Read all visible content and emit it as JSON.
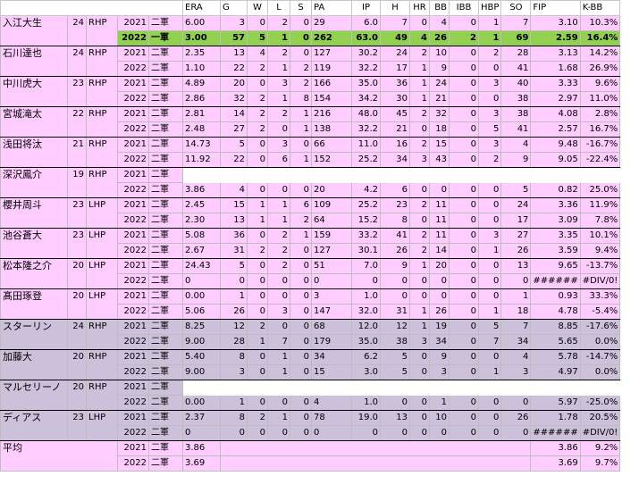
{
  "headers": [
    "ERA",
    "G",
    "W",
    "L",
    "S",
    "PA",
    "IP",
    "H",
    "HR",
    "BB",
    "IBB",
    "HBP",
    "SO",
    "FIP",
    "K-BB"
  ],
  "players": [
    {
      "name": "入江大生",
      "age": "24",
      "throws": "RHP",
      "bg": "pink",
      "rows": [
        {
          "year": "2021",
          "level": "二軍",
          "stats": [
            "6.00",
            "3",
            "0",
            "2",
            "0",
            "29",
            "6.0",
            "7",
            "0",
            "4",
            "0",
            "1",
            "7",
            "3.10",
            "10.3%"
          ]
        },
        {
          "year": "2022",
          "level": "一軍",
          "highlight": true,
          "stats": [
            "3.00",
            "57",
            "5",
            "1",
            "0",
            "262",
            "63.0",
            "49",
            "4",
            "26",
            "2",
            "1",
            "69",
            "2.59",
            "16.4%"
          ]
        }
      ]
    },
    {
      "name": "石川達也",
      "age": "24",
      "throws": "RHP",
      "bg": "pink",
      "rows": [
        {
          "year": "2021",
          "level": "二軍",
          "stats": [
            "2.35",
            "13",
            "4",
            "2",
            "0",
            "127",
            "30.2",
            "24",
            "2",
            "10",
            "0",
            "2",
            "28",
            "3.13",
            "14.2%"
          ]
        },
        {
          "year": "2022",
          "level": "二軍",
          "stats": [
            "1.10",
            "22",
            "2",
            "1",
            "2",
            "119",
            "32.2",
            "17",
            "1",
            "9",
            "0",
            "0",
            "41",
            "1.68",
            "26.9%"
          ]
        }
      ]
    },
    {
      "name": "中川虎大",
      "age": "23",
      "throws": "RHP",
      "bg": "pink",
      "rows": [
        {
          "year": "2021",
          "level": "二軍",
          "stats": [
            "4.89",
            "20",
            "0",
            "3",
            "2",
            "166",
            "35.0",
            "36",
            "1",
            "24",
            "0",
            "3",
            "40",
            "3.33",
            "9.6%"
          ]
        },
        {
          "year": "2022",
          "level": "二軍",
          "stats": [
            "2.86",
            "32",
            "2",
            "1",
            "8",
            "154",
            "34.2",
            "30",
            "1",
            "21",
            "0",
            "0",
            "38",
            "2.97",
            "11.0%"
          ]
        }
      ]
    },
    {
      "name": "宮城滝太",
      "age": "22",
      "throws": "RHP",
      "bg": "pink",
      "rows": [
        {
          "year": "2021",
          "level": "二軍",
          "stats": [
            "2.81",
            "14",
            "2",
            "2",
            "1",
            "216",
            "48.0",
            "45",
            "2",
            "32",
            "0",
            "3",
            "38",
            "4.08",
            "2.8%"
          ]
        },
        {
          "year": "2022",
          "level": "二軍",
          "stats": [
            "2.48",
            "27",
            "2",
            "0",
            "1",
            "138",
            "32.2",
            "21",
            "0",
            "18",
            "0",
            "5",
            "41",
            "2.57",
            "16.7%"
          ]
        }
      ]
    },
    {
      "name": "浅田将汰",
      "age": "21",
      "throws": "RHP",
      "bg": "pink",
      "rows": [
        {
          "year": "2021",
          "level": "二軍",
          "stats": [
            "14.73",
            "5",
            "0",
            "3",
            "0",
            "66",
            "11.0",
            "16",
            "2",
            "15",
            "0",
            "3",
            "4",
            "9.48",
            "-16.7%"
          ]
        },
        {
          "year": "2022",
          "level": "二軍",
          "stats": [
            "11.92",
            "22",
            "0",
            "6",
            "1",
            "152",
            "25.2",
            "34",
            "3",
            "43",
            "0",
            "2",
            "9",
            "9.05",
            "-22.4%"
          ]
        }
      ]
    },
    {
      "name": "深沢鳳介",
      "age": "19",
      "throws": "RHP",
      "bg": "pink",
      "rows": [
        {
          "year": "2021",
          "level": "二軍",
          "blank": true,
          "stats": [
            "",
            "",
            "",
            "",
            "",
            "",
            "",
            "",
            "",
            "",
            "",
            "",
            "",
            "",
            ""
          ]
        },
        {
          "year": "2022",
          "level": "二軍",
          "stats": [
            "3.86",
            "4",
            "0",
            "0",
            "0",
            "20",
            "4.2",
            "6",
            "0",
            "0",
            "0",
            "0",
            "5",
            "0.82",
            "25.0%"
          ]
        }
      ]
    },
    {
      "name": "櫻井周斗",
      "age": "23",
      "throws": "LHP",
      "bg": "pink",
      "rows": [
        {
          "year": "2021",
          "level": "二軍",
          "stats": [
            "2.45",
            "15",
            "1",
            "1",
            "6",
            "109",
            "25.2",
            "23",
            "2",
            "11",
            "0",
            "0",
            "24",
            "3.36",
            "11.9%"
          ]
        },
        {
          "year": "2022",
          "level": "二軍",
          "stats": [
            "2.30",
            "13",
            "1",
            "1",
            "2",
            "64",
            "15.2",
            "8",
            "0",
            "11",
            "0",
            "0",
            "17",
            "3.09",
            "7.8%"
          ]
        }
      ]
    },
    {
      "name": "池谷蒼大",
      "age": "23",
      "throws": "LHP",
      "bg": "pink",
      "rows": [
        {
          "year": "2021",
          "level": "二軍",
          "stats": [
            "5.08",
            "36",
            "0",
            "2",
            "1",
            "159",
            "33.2",
            "41",
            "2",
            "11",
            "0",
            "3",
            "27",
            "3.35",
            "10.1%"
          ]
        },
        {
          "year": "2022",
          "level": "二軍",
          "stats": [
            "2.67",
            "31",
            "2",
            "2",
            "0",
            "127",
            "30.1",
            "26",
            "2",
            "14",
            "0",
            "1",
            "26",
            "3.59",
            "9.4%"
          ]
        }
      ]
    },
    {
      "name": "松本隆之介",
      "age": "20",
      "throws": "LHP",
      "bg": "pink",
      "rows": [
        {
          "year": "2021",
          "level": "二軍",
          "stats": [
            "24.43",
            "5",
            "0",
            "2",
            "0",
            "51",
            "7.0",
            "9",
            "1",
            "20",
            "0",
            "0",
            "13",
            "9.65",
            "-13.7%"
          ]
        },
        {
          "year": "2022",
          "level": "二軍",
          "stats": [
            "0",
            "0",
            "0",
            "0",
            "0",
            "0",
            "0",
            "0",
            "0",
            "0",
            "0",
            "0",
            "0",
            "######",
            "#DIV/0!"
          ]
        }
      ]
    },
    {
      "name": "髙田琢登",
      "age": "20",
      "throws": "LHP",
      "bg": "pink",
      "rows": [
        {
          "year": "2021",
          "level": "二軍",
          "stats": [
            "0.00",
            "1",
            "0",
            "0",
            "0",
            "3",
            "1.0",
            "0",
            "0",
            "0",
            "0",
            "0",
            "1",
            "0.93",
            "33.3%"
          ]
        },
        {
          "year": "2022",
          "level": "二軍",
          "stats": [
            "5.06",
            "26",
            "0",
            "3",
            "0",
            "147",
            "32.0",
            "31",
            "1",
            "26",
            "0",
            "1",
            "18",
            "4.78",
            "-5.4%"
          ]
        }
      ]
    },
    {
      "name": "スターリン",
      "age": "24",
      "throws": "RHP",
      "bg": "gray",
      "rows": [
        {
          "year": "2021",
          "level": "二軍",
          "stats": [
            "8.25",
            "12",
            "2",
            "0",
            "0",
            "68",
            "12.0",
            "12",
            "1",
            "19",
            "0",
            "5",
            "7",
            "8.85",
            "-17.6%"
          ]
        },
        {
          "year": "2022",
          "level": "二軍",
          "stats": [
            "9.00",
            "28",
            "1",
            "7",
            "0",
            "179",
            "35.0",
            "38",
            "3",
            "34",
            "0",
            "7",
            "34",
            "5.65",
            "0.0%"
          ]
        }
      ]
    },
    {
      "name": "加藤大",
      "age": "20",
      "throws": "RHP",
      "bg": "gray",
      "rows": [
        {
          "year": "2021",
          "level": "二軍",
          "stats": [
            "5.40",
            "8",
            "0",
            "1",
            "0",
            "34",
            "6.2",
            "5",
            "0",
            "9",
            "0",
            "0",
            "4",
            "5.78",
            "-14.7%"
          ]
        },
        {
          "year": "2022",
          "level": "二軍",
          "stats": [
            "9.00",
            "3",
            "0",
            "1",
            "0",
            "15",
            "3.0",
            "5",
            "0",
            "3",
            "0",
            "1",
            "3",
            "4.97",
            "0.0%"
          ]
        }
      ]
    },
    {
      "name": "マルセリーノ",
      "age": "20",
      "throws": "RHP",
      "bg": "gray",
      "rows": [
        {
          "year": "2021",
          "level": "二軍",
          "blank": true,
          "stats": [
            "",
            "",
            "",
            "",
            "",
            "",
            "",
            "",
            "",
            "",
            "",
            "",
            "",
            "",
            ""
          ]
        },
        {
          "year": "2022",
          "level": "二軍",
          "stats": [
            "0.00",
            "1",
            "0",
            "0",
            "0",
            "4",
            "1.0",
            "0",
            "0",
            "1",
            "0",
            "0",
            "0",
            "5.97",
            "-25.0%"
          ]
        }
      ]
    },
    {
      "name": "ディアス",
      "age": "23",
      "throws": "LHP",
      "bg": "gray",
      "rows": [
        {
          "year": "2021",
          "level": "二軍",
          "stats": [
            "2.37",
            "8",
            "2",
            "1",
            "0",
            "78",
            "19.0",
            "13",
            "0",
            "10",
            "0",
            "0",
            "26",
            "1.78",
            "20.5%"
          ]
        },
        {
          "year": "2022",
          "level": "二軍",
          "stats": [
            "0",
            "0",
            "0",
            "0",
            "0",
            "0",
            "0",
            "0",
            "0",
            "0",
            "0",
            "0",
            "0",
            "######",
            "#DIV/0!"
          ]
        }
      ]
    }
  ],
  "average": {
    "name": "平均",
    "rows": [
      {
        "year": "2021",
        "level": "二軍",
        "era": "3.86",
        "fip": "3.86",
        "kbb": "9.2%"
      },
      {
        "year": "2022",
        "level": "二軍",
        "era": "3.69",
        "fip": "3.69",
        "kbb": "9.7%"
      }
    ]
  }
}
